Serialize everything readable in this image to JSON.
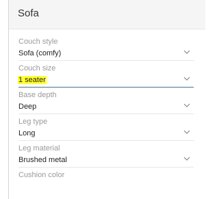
{
  "panel": {
    "title": "Sofa"
  },
  "fields": [
    {
      "label": "Couch style",
      "value": "Sofa (comfy)",
      "has_chevron": true,
      "highlighted": false,
      "active": false
    },
    {
      "label": "Couch size",
      "value": "1 seater",
      "has_chevron": true,
      "highlighted": true,
      "active": true
    },
    {
      "label": "Base depth",
      "value": "Deep",
      "has_chevron": true,
      "highlighted": false,
      "active": false
    },
    {
      "label": "Leg type",
      "value": "Long",
      "has_chevron": true,
      "highlighted": false,
      "active": false
    },
    {
      "label": "Leg material",
      "value": "Brushed metal",
      "has_chevron": true,
      "highlighted": false,
      "active": false
    },
    {
      "label": "Cushion color",
      "value": "",
      "has_chevron": false,
      "highlighted": false,
      "active": false
    }
  ],
  "colors": {
    "highlight": "#ffff3a",
    "active_underline": "#2a7ab8"
  },
  "icons": {
    "dropdown": "chevron-down-icon"
  }
}
